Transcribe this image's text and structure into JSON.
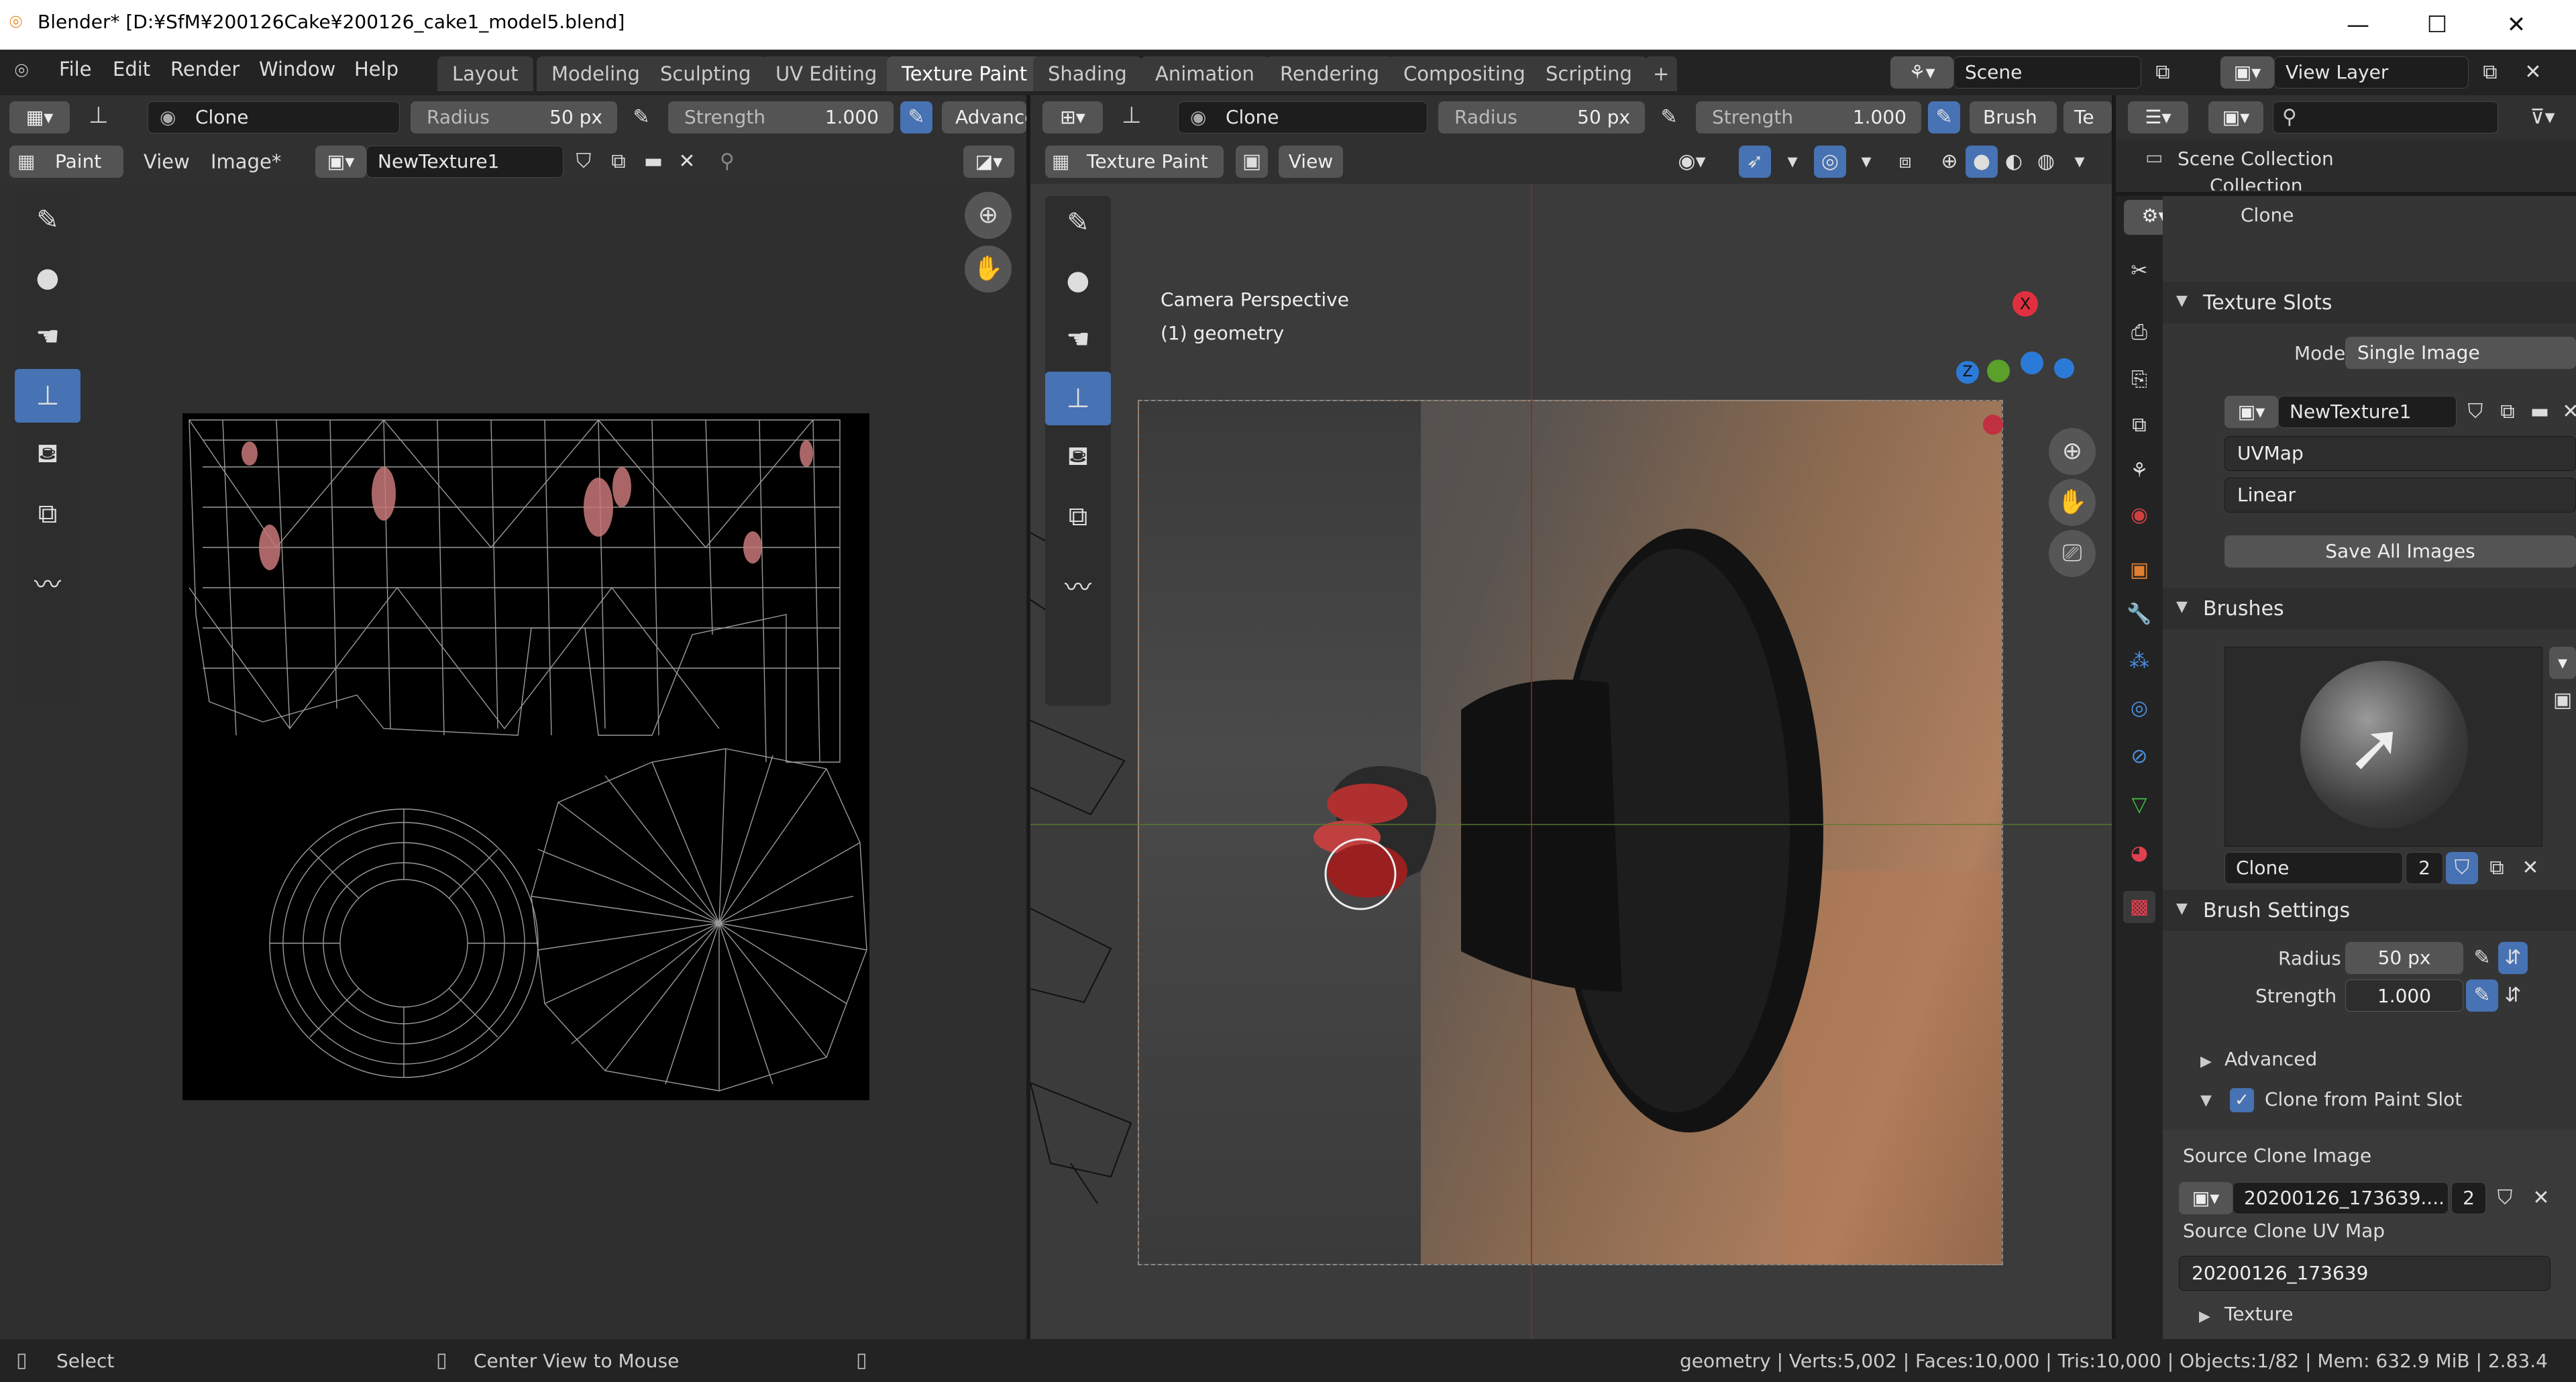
{
  "window": {
    "title": "Blender* [D:¥SfM¥200126Cake¥200126_cake1_model5.blend]",
    "min": "—",
    "max": "☐",
    "close": "✕"
  },
  "menu": [
    "File",
    "Edit",
    "Render",
    "Window",
    "Help"
  ],
  "workspaces": [
    "Layout",
    "Modeling",
    "Sculpting",
    "UV Editing",
    "Texture Paint",
    "Shading",
    "Animation",
    "Rendering",
    "Compositing",
    "Scripting"
  ],
  "add_tab": "+",
  "scene": {
    "label": "Scene",
    "view_layer": "View Layer"
  },
  "left": {
    "brush": "Clone",
    "radius_label": "Radius",
    "radius": "50 px",
    "strength_label": "Strength",
    "strength": "1.000",
    "advanced": "Advanced",
    "mode": "Paint",
    "view": "View",
    "image": "Image*",
    "texture": "NewTexture1"
  },
  "right": {
    "brush": "Clone",
    "radius_label": "Radius",
    "radius": "50 px",
    "strength_label": "Strength",
    "strength": "1.000",
    "brush_menu": "Brush",
    "tex_menu": "Te",
    "mode": "Texture Paint",
    "view": "View",
    "overlay1": "Camera Perspective",
    "overlay2": "(1) geometry"
  },
  "outliner": {
    "scene_collection": "Scene Collection",
    "collection": "Collection"
  },
  "props": {
    "top_brush": "Clone",
    "texture_slots": "Texture Slots",
    "mode_label": "Mode",
    "mode_value": "Single Image",
    "texture": "NewTexture1",
    "uvmap": "UVMap",
    "interp": "Linear",
    "save_all": "Save All Images",
    "brushes": "Brushes",
    "brush_name": "Clone",
    "brush_users": "2",
    "brush_settings": "Brush Settings",
    "radius_label": "Radius",
    "radius": "50 px",
    "strength_label": "Strength",
    "strength": "1.000",
    "advanced": "Advanced",
    "clone_from_slot": "Clone from Paint Slot",
    "source_clone_image": "Source Clone Image",
    "clone_image": "20200126_173639....",
    "clone_users": "2",
    "source_clone_uv": "Source Clone UV Map",
    "clone_uv": "20200126_173639",
    "texture_sub": "Texture"
  },
  "status": {
    "select": "Select",
    "center": "Center View to Mouse",
    "info": "geometry | Verts:5,002 | Faces:10,000 | Tris:10,000 | Objects:1/82 | Mem: 632.9 MiB | 2.83.4"
  },
  "icons": [
    "blender-logo-icon",
    "brush-icon",
    "drop-icon",
    "smear-icon",
    "clone-stamp-icon",
    "fill-icon",
    "mask-icon",
    "annotate-icon",
    "zoom-icon",
    "hand-icon",
    "camera-icon",
    "search-icon",
    "filter-icon"
  ]
}
